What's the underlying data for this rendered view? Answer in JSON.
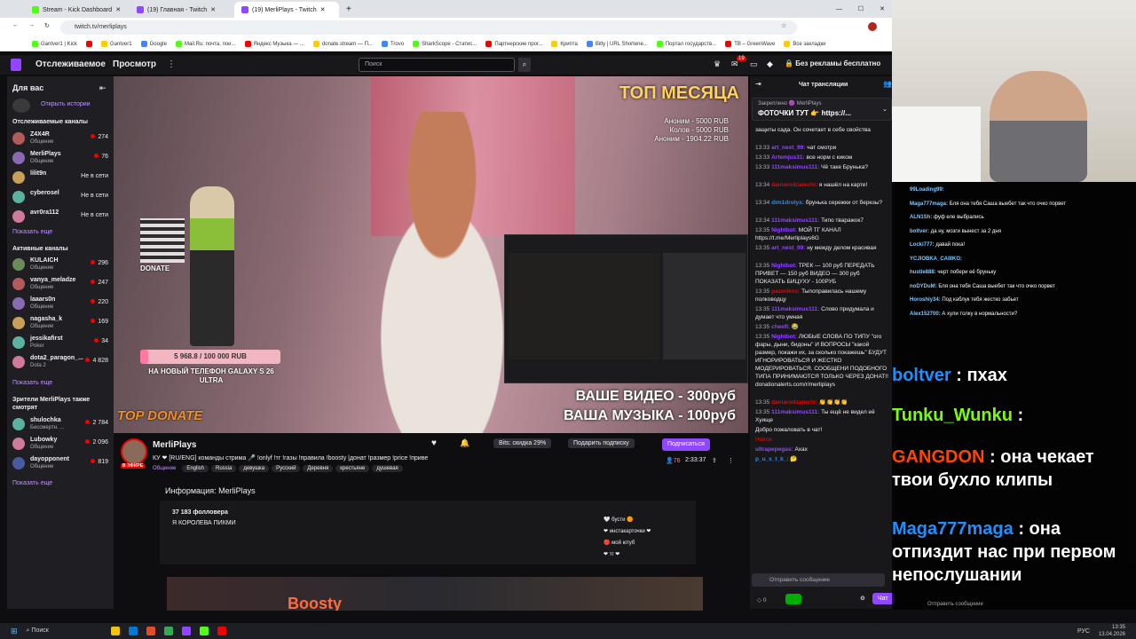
{
  "browser": {
    "tabs": [
      {
        "label": "Stream - Kick Dashboard",
        "color": "#53fc18",
        "active": false
      },
      {
        "label": "(19) Главная - Twitch",
        "color": "#9147ff",
        "active": false
      },
      {
        "label": "(19) MerliPlays - Twitch",
        "color": "#9147ff",
        "active": true
      }
    ],
    "url": "twitch.tv/merliplays",
    "bookmarks": [
      "Gantver1 | Kick",
      "",
      "Gantver1",
      "Google",
      "Mail.Ru: почта, пои...",
      "Яндекс Музыка — ...",
      "donate.stream — П...",
      "Trovo",
      "SharkScope - Статис...",
      "Партнерские прог...",
      "Крипта",
      "Bitly | URL Shortene...",
      "Портал государств...",
      "TB – GreenWave",
      "Все закладки"
    ]
  },
  "nav": {
    "following": "Отслеживаемое",
    "browse": "Просмотр",
    "more": "⋮",
    "search_placeholder": "Поиск",
    "notif_badge": "19",
    "no_ads": "Без рекламы бесплатно"
  },
  "sidebar": {
    "for_you": "Для вас",
    "open_history": "Открыть истории",
    "followed_header": "Отслеживаемые каналы",
    "followed": [
      {
        "name": "Z4X4R",
        "game": "Общение",
        "count": "274",
        "live": true
      },
      {
        "name": "MerliPlays",
        "game": "Общение",
        "count": "76",
        "live": true
      },
      {
        "name": "lilit9n",
        "game": "",
        "count": "Не в сети",
        "live": false
      },
      {
        "name": "cyberosel",
        "game": "",
        "count": "Не в сети",
        "live": false
      },
      {
        "name": "avr0ra112",
        "game": "",
        "count": "Не в сети",
        "live": false
      }
    ],
    "show_more": "Показать еще",
    "active_header": "Активные каналы",
    "active": [
      {
        "name": "KULAICH",
        "game": "Общение",
        "count": "296"
      },
      {
        "name": "vanya_meladze",
        "game": "Общение",
        "count": "247"
      },
      {
        "name": "laaars0n",
        "game": "Общение",
        "count": "220"
      },
      {
        "name": "nagasha_k",
        "game": "Общение",
        "count": "169"
      },
      {
        "name": "jessikafirst",
        "game": "Poker",
        "count": "34"
      },
      {
        "name": "dota2_paragon_...",
        "game": "Dota 2",
        "count": "4 828"
      }
    ],
    "show_more2": "Показать еще",
    "viewers_header": "Зрители MerliPlays также смотрят",
    "viewers_also": [
      {
        "name": "shulochka",
        "game": "Бессмертн. ...",
        "count": "2 784"
      },
      {
        "name": "Lubowky",
        "game": "Общение",
        "count": "2 096"
      },
      {
        "name": "dayopponent",
        "game": "Общение",
        "count": "819"
      }
    ],
    "show_more3": "Показать еще"
  },
  "video": {
    "top_month": "ТОП МЕСЯЦА",
    "donors": [
      "Аноним - 5000 RUB",
      "Колов - 5000 RUB",
      "Аноним - 1904.22 RUB"
    ],
    "goal_value": "5 968.8 / 100 000 RUB",
    "goal_fraction": 0.06,
    "goal_text": "НА НОВЫЙ ТЕЛЕФОН GALAXY S 26 ULTRA",
    "top_donate": "TOP DONATE",
    "donate_label": "DONATE",
    "price_video": "ВАШЕ ВИДЕО - 300руб",
    "price_music": "ВАША МУЗЫКА - 100руб"
  },
  "stream": {
    "name": "MerliPlays",
    "live_badge": "В ЭФИРЕ",
    "title": "КУ ❤ [RU/ENG] команды стрима 🎤 !onlyf !тг !газы !правила !boosty |донат !размер !price !приве",
    "category": "Общение",
    "tags": [
      "English",
      "Russia",
      "девушка",
      "Русский",
      "Деревня",
      "крестьяне",
      "душевая"
    ],
    "bits_discount": "Bits: скидка 29%",
    "gift_sub": "Подарить подписку",
    "subscribe": "Подписаться",
    "viewers": "76",
    "uptime": "2:33:37",
    "about_header": "Информация: MerliPlays",
    "followers": "37 183 фолловера",
    "bio": "Я КОРОЛЕВА ПИКМИ",
    "links": [
      "🤍 бусти 🟠",
      "❤ инстакарточки ❤",
      "🔴 мой ютуб",
      "❤ тг ❤"
    ],
    "panels_banner": "Boosty"
  },
  "chat": {
    "header": "Чат трансляции",
    "pinned_by": "Закреплено 🟣 MerliPlays",
    "pinned_text": "ФОТОЧКИ ТУТ 👉 https://...",
    "messages": [
      {
        "ts": "",
        "user": "",
        "color": "#efeff1",
        "text": "защиты сада. Он сочетает в себе свойства"
      },
      {
        "ts": "13:33",
        "user": "art_next_99:",
        "color": "#9147ff",
        "text": "чат смотри"
      },
      {
        "ts": "13:33",
        "user": "Artemjus31:",
        "color": "#9147ff",
        "text": "все норм с киком"
      },
      {
        "ts": "13:33",
        "user": "111maksimus111:",
        "color": "#9147ff",
        "text": "Чё таке Брунька?"
      },
      {
        "ts": "13:34",
        "user": "daniarodzarechi:",
        "color": "#eb0400",
        "text": "я нашёл на карте!"
      },
      {
        "ts": "13:34",
        "user": "dim1drolys:",
        "color": "#1e90ff",
        "text": "брунька сережки от березы?"
      },
      {
        "ts": "13:34",
        "user": "111maksimus111:",
        "color": "#9147ff",
        "text": "Типо тваражок7"
      },
      {
        "ts": "13:35",
        "user": "Nightbot:",
        "color": "#9147ff",
        "text": "МОЙ ТГ КАНАЛ https://t.me/Merliplays6G"
      },
      {
        "ts": "13:35",
        "user": "art_next_99:",
        "color": "#9147ff",
        "text": "ну между делом красивая"
      },
      {
        "ts": "13:35",
        "user": "Nightbot:",
        "color": "#9147ff",
        "text": "ТРЕК — 100 руб ПЕРЕДАТЬ ПРИВЕТ — 150 руб ВИДЕО — 300 руб ПОКАЗАТЬ БИЦУХУ - 100РУБ"
      },
      {
        "ts": "13:35",
        "user": "pazorikxs:",
        "color": "#eb0400",
        "text": "Тыпоправилась нашему полководцу"
      },
      {
        "ts": "13:35",
        "user": "111maksimus111:",
        "color": "#9147ff",
        "text": "Слово придумала и думает что умная"
      },
      {
        "ts": "13:35",
        "user": "cheefi:",
        "color": "#9147ff",
        "text": "😂"
      },
      {
        "ts": "13:35",
        "user": "Nightbot:",
        "color": "#9147ff",
        "text": "ЛЮБЫЕ СЛОВА ПО ТИПУ \"ого фары, дыни, бидоны\" И ВОПРОСЫ \"какой размер, покажи их, за сколько покажешь\" БУДУТ ИГНОРИРОВАТЬСЯ И ЖЕСТКО МОДЕРИРОВАТЬСЯ. СООБЩЕНИ ПОДОБНОГО ТИПА ПРИНИМАЮТСЯ ТОЛЬКО ЧЕРЕЗ ДОНАТ!! donationalerts.com/r/merliplays"
      },
      {
        "ts": "13:35",
        "user": "daniarodzarechi:",
        "color": "#eb0400",
        "text": "👏👏👏👏"
      },
      {
        "ts": "13:35",
        "user": "111maksimus111:",
        "color": "#9147ff",
        "text": "Ты ещё не видел её Хуище"
      },
      {
        "ts": "",
        "user": "",
        "color": "#efeff1",
        "text": "Добро пожаловать в чат!"
      },
      {
        "ts": "",
        "user": "",
        "color": "#eb0400",
        "text": "Новое"
      },
      {
        "ts": "",
        "user": "ultrapepegas:",
        "color": "#9147ff",
        "text": "Ахах"
      },
      {
        "ts": "",
        "user": "p_u_s_t_k_:",
        "color": "#1e90ff",
        "text": "🤔"
      }
    ],
    "input_placeholder": "Отправить сообщение",
    "points": "0",
    "send": "Чат"
  },
  "overlay": {
    "small_chat": [
      {
        "user": "99Loading99:",
        "text": ""
      },
      {
        "user": "Maga777maga:",
        "text": "Бля она тебя Саша выебет так что очко порвет"
      },
      {
        "user": "ALN1Sh:",
        "text": "фуф еле выбрались"
      },
      {
        "user": "boltver:",
        "text": "да ну, мозги вынест за 2 дня"
      },
      {
        "user": "Locki777:",
        "text": "давай пока!"
      },
      {
        "user": "YCJIOBKA_CAIIIKO:",
        "text": ""
      },
      {
        "user": "hustle888:",
        "text": "черт побери её бруньку"
      },
      {
        "user": "noDYDuM:",
        "text": "Бля она тебя Саша выебет так что очко порвет"
      },
      {
        "user": "Horoshiy34:",
        "text": "Под каблук тебя жестко забьет"
      },
      {
        "user": "Alex152700:",
        "text": "А хули толку в нормальности?"
      }
    ],
    "big_lines": [
      {
        "user": "boltver",
        "text": ": пхах",
        "color": "#1e90ff"
      },
      {
        "user": "Tunku_Wunku",
        "text": ":",
        "color": "#7cfc00"
      },
      {
        "user": "GANGDON",
        "text": ": она чекает твои бухло клипы",
        "color": "#ff4500"
      },
      {
        "user": "Maga777maga",
        "text": ": она отпиздит нас при первом непослушании",
        "color": "#1e90ff"
      }
    ],
    "send_placeholder": "Отправить сообщение"
  },
  "taskbar": {
    "search": "Поиск",
    "time": "13:35",
    "date": "13.04.2026",
    "lang": "РУС"
  }
}
